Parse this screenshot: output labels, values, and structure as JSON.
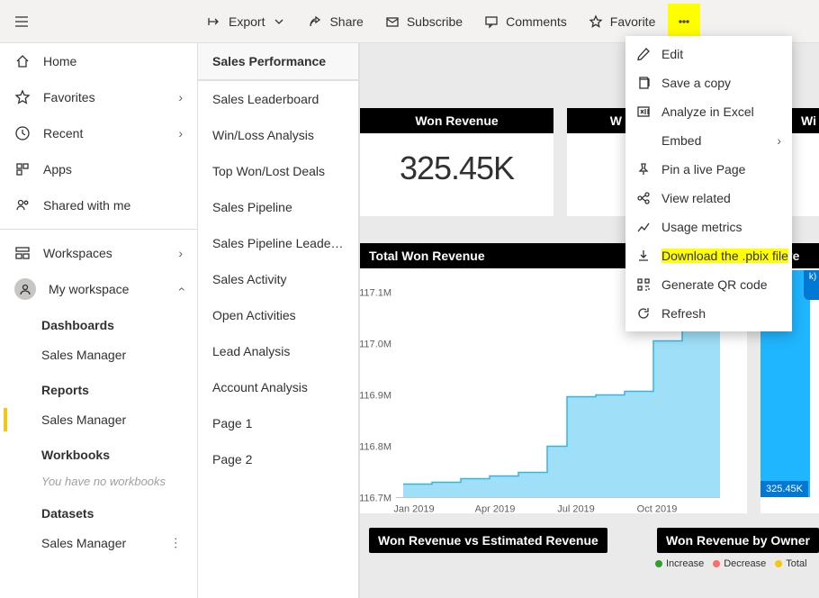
{
  "toolbar": {
    "export": "Export",
    "share": "Share",
    "subscribe": "Subscribe",
    "comments": "Comments",
    "favorite": "Favorite"
  },
  "nav": {
    "home": "Home",
    "favorites": "Favorites",
    "recent": "Recent",
    "apps": "Apps",
    "shared": "Shared with me",
    "workspaces": "Workspaces",
    "my_workspace": "My workspace",
    "sections": {
      "dashboards": "Dashboards",
      "dashboards_item": "Sales Manager",
      "reports": "Reports",
      "reports_item": "Sales Manager",
      "workbooks": "Workbooks",
      "workbooks_empty": "You have no workbooks",
      "datasets": "Datasets",
      "datasets_item": "Sales Manager"
    }
  },
  "pages": {
    "header": "Sales Performance",
    "items": [
      "Sales Leaderboard",
      "Win/Loss Analysis",
      "Top Won/Lost Deals",
      "Sales Pipeline",
      "Sales Pipeline Leaderbo...",
      "Sales Activity",
      "Open Activities",
      "Lead Analysis",
      "Account Analysis",
      "Page 1",
      "Page 2"
    ]
  },
  "tiles": {
    "won_rev_title": "Won Revenue",
    "won_rev_value": "325.45K",
    "won_rev_peek1": "W",
    "won_rev_peek2": "Wi",
    "total_won_title": "Total Won Revenue",
    "rev_peek": "Reve",
    "badge": "325.45K",
    "bottom_left": "Won Revenue vs Estimated Revenue",
    "bottom_right": "Won Revenue by Owner",
    "legend_increase": "Increase",
    "legend_decrease": "Decrease",
    "legend_total": "Total"
  },
  "menu": {
    "edit": "Edit",
    "save_copy": "Save a copy",
    "analyze": "Analyze in Excel",
    "embed": "Embed",
    "pin": "Pin a live Page",
    "view_related": "View related",
    "usage": "Usage metrics",
    "download": "Download the .pbix file",
    "qr": "Generate QR code",
    "refresh": "Refresh"
  },
  "chart_data": {
    "type": "area",
    "title": "Total Won Revenue",
    "xlabel": "",
    "ylabel": "",
    "ylim": [
      116.7,
      117.1
    ],
    "y_ticks": [
      "117.1M",
      "117.0M",
      "116.9M",
      "116.8M",
      "116.7M"
    ],
    "x_ticks": [
      "Jan 2019",
      "Apr 2019",
      "Jul 2019",
      "Oct 2019"
    ],
    "series": [
      {
        "name": "Total Won Revenue",
        "x": [
          "Jan 2019",
          "Feb 2019",
          "Mar 2019",
          "Apr 2019",
          "May 2019",
          "Jun 2019",
          "Jul 2019",
          "Aug 2019",
          "Sep 2019",
          "Oct 2019",
          "Nov 2019"
        ],
        "values": [
          116.73,
          116.75,
          116.75,
          116.77,
          116.78,
          116.79,
          116.9,
          116.9,
          116.92,
          117.02,
          117.05
        ]
      }
    ]
  }
}
